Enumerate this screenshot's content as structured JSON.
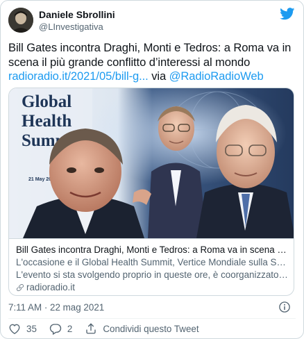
{
  "header": {
    "display_name": "Daniele Sbrollini",
    "handle": "@LInvestigativa"
  },
  "tweet": {
    "text": "Bill Gates incontra Draghi, Monti e Tedros: a Roma va in scena il più grande conflitto d’interessi al mondo ",
    "link_text": "radioradio.it/2021/05/bill-g...",
    "via_text": " via ",
    "mention": "@RadioRadioWeb"
  },
  "card": {
    "image_title_lines": [
      "Global",
      "Health",
      "Summit"
    ],
    "image_date": "21 May 2021, Rome",
    "title": "Bill Gates incontra Draghi, Monti e Tedros: a Roma va in scena il più gra...",
    "description_line1": "L'occasione e il Global Health Summit, Vertice Mondiale sulla Salute.",
    "description_line2": "L'evento si sta svolgendo proprio in queste ore, è coorganizzato dall'Itali...",
    "domain": "radioradio.it"
  },
  "meta": {
    "timestamp": "7:11 AM · 22 mag 2021"
  },
  "actions": {
    "likes": "35",
    "replies": "2",
    "share_label": "Condividi questo Tweet"
  },
  "colors": {
    "link": "#1d9bf0",
    "like": "#f91880",
    "text_primary": "#0f1419",
    "text_secondary": "#536471",
    "border": "#cfd9de"
  },
  "icons": [
    "avatar",
    "twitter-bird-icon",
    "link-icon",
    "info-icon",
    "heart-icon",
    "reply-icon",
    "share-icon"
  ]
}
